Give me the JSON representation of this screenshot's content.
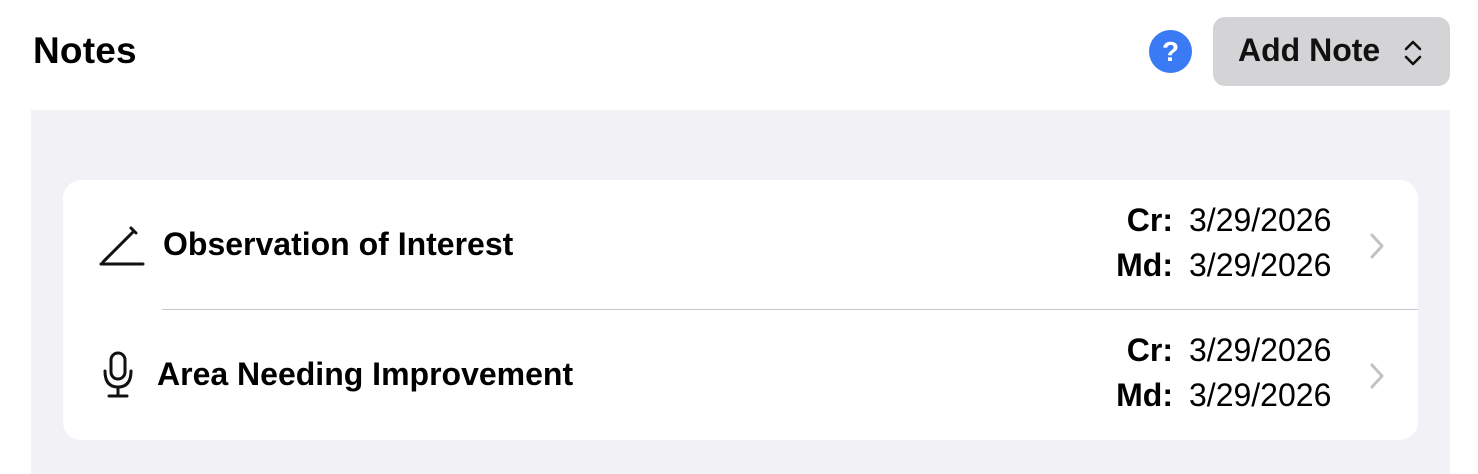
{
  "header": {
    "title": "Notes",
    "help_label": "?",
    "add_note_label": "Add Note"
  },
  "notes": [
    {
      "icon": "pencil-icon",
      "title": "Observation of Interest",
      "created_label": "Cr:",
      "created": "3/29/2026",
      "modified_label": "Md:",
      "modified": "3/29/2026"
    },
    {
      "icon": "microphone-icon",
      "title": "Area Needing Improvement",
      "created_label": "Cr:",
      "created": "3/29/2026",
      "modified_label": "Md:",
      "modified": "3/29/2026"
    }
  ],
  "colors": {
    "accent": "#3a7af5",
    "button_bg": "#d4d4d6",
    "panel_bg": "#f1f1f6"
  }
}
